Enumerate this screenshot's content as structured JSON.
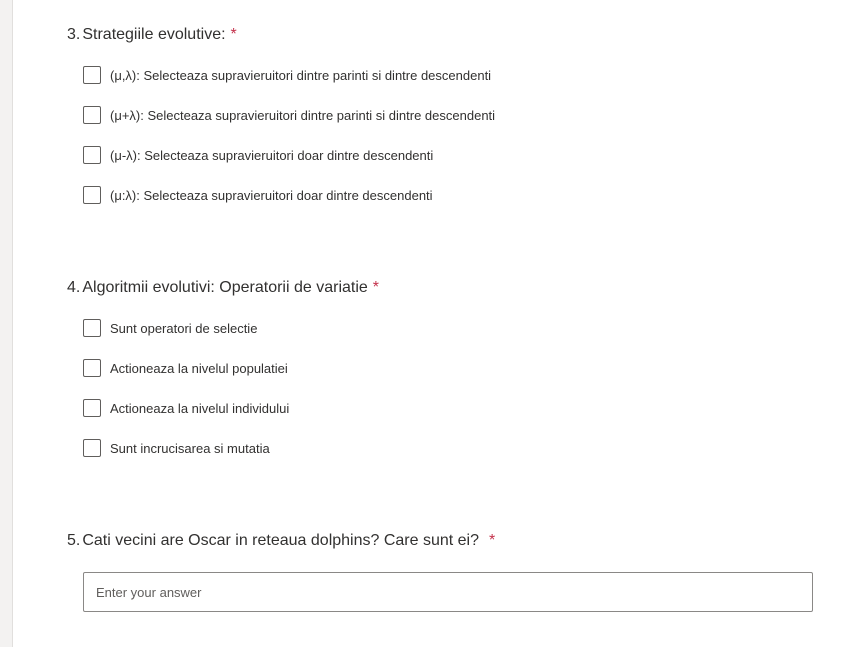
{
  "questions": [
    {
      "number": "3.",
      "title": "Strategiile evolutive:",
      "required_mark": "*",
      "options": [
        "(μ,λ): Selecteaza supravieruitori dintre parinti si dintre descendenti",
        "(μ+λ): Selecteaza supravieruitori dintre parinti si dintre descendenti",
        "(μ-λ): Selecteaza supravieruitori doar dintre descendenti",
        "(μ:λ): Selecteaza supravieruitori doar dintre descendenti"
      ]
    },
    {
      "number": "4.",
      "title": "Algoritmii evolutivi: Operatorii de variatie",
      "required_mark": "*",
      "options": [
        "Sunt operatori de selectie",
        "Actioneaza la nivelul populatiei",
        "Actioneaza la nivelul individului",
        "Sunt incrucisarea si mutatia"
      ]
    },
    {
      "number": "5.",
      "title": "Cati vecini are Oscar in reteaua dolphins? Care sunt ei?",
      "required_mark": "*",
      "answer": {
        "value": "",
        "placeholder": "Enter your answer"
      }
    }
  ],
  "colors": {
    "required": "#c4314b",
    "text": "#323130",
    "checkbox_border": "#605e5c",
    "input_border": "#8a8886"
  }
}
